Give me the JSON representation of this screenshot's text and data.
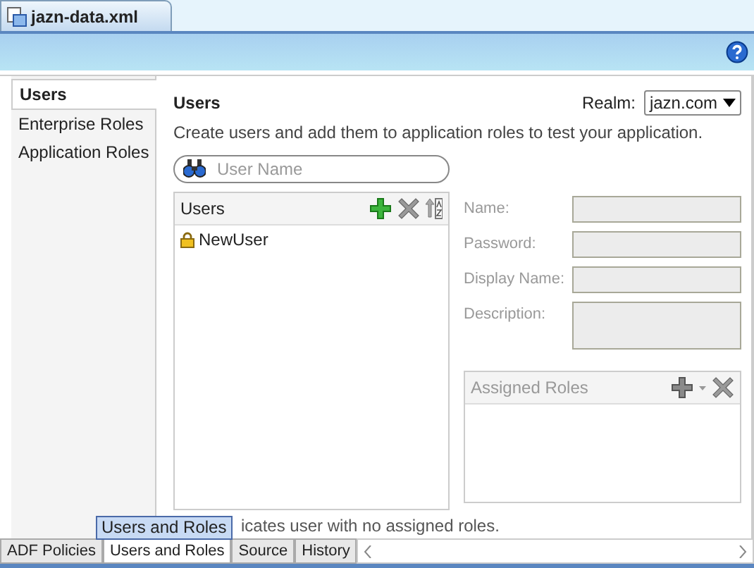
{
  "file_tab": {
    "label": "jazn-data.xml",
    "selected": true
  },
  "nav": [
    {
      "label": "Users",
      "selected": true
    },
    {
      "label": "Enterprise Roles",
      "selected": false
    },
    {
      "label": "Application Roles",
      "selected": false
    }
  ],
  "section": {
    "title": "Users",
    "description": "Create users and add them to application roles to test your application."
  },
  "realm": {
    "label": "Realm:",
    "value": "jazn.com"
  },
  "search": {
    "placeholder": "User Name"
  },
  "users_list": {
    "title": "Users",
    "items": [
      {
        "name": "NewUser",
        "selected": false
      }
    ]
  },
  "form": [
    {
      "label": "Name:",
      "kind": "line",
      "disabled": true
    },
    {
      "label": "Password:",
      "kind": "line",
      "disabled": true
    },
    {
      "label": "Display Name:",
      "kind": "line",
      "disabled": true
    },
    {
      "label": "Description:",
      "kind": "area",
      "disabled": true
    }
  ],
  "assigned_roles": {
    "title": "Assigned Roles",
    "disabled": true
  },
  "note": "icates user with no assigned roles.",
  "tooltip": "Users and Roles",
  "bottom_tabs": [
    {
      "label": "ADF Policies",
      "selected": false
    },
    {
      "label": "Users and Roles",
      "selected": true
    },
    {
      "label": "Source",
      "selected": false
    },
    {
      "label": "History",
      "selected": false
    }
  ]
}
